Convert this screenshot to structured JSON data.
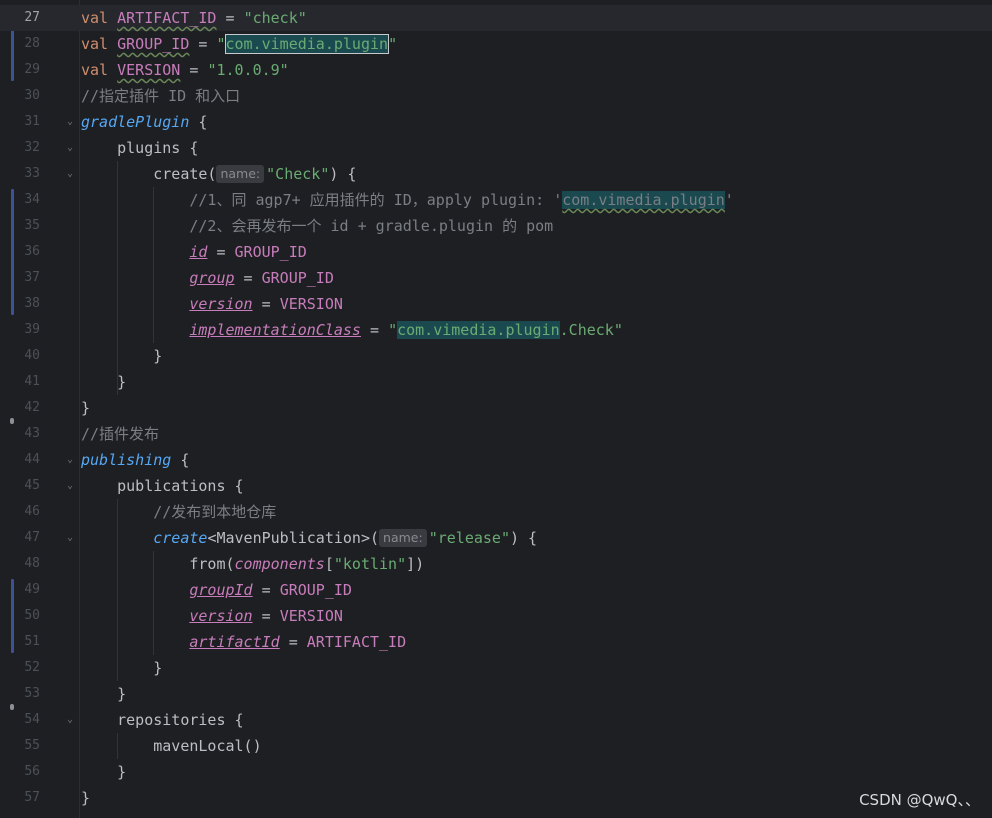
{
  "lines": {
    "l27": {
      "num": "27",
      "a": "val",
      "b": " ",
      "c": "ARTIFACT_ID",
      "d": " = ",
      "e": "\"check\""
    },
    "l28": {
      "num": "28",
      "a": "val",
      "b": " ",
      "c": "GROUP_ID",
      "d": " = ",
      "e": "\"",
      "f": "com.vimedia.plugin",
      "g": "\""
    },
    "l29": {
      "num": "29",
      "a": "val",
      "b": " ",
      "c": "VERSION",
      "d": " = ",
      "e": "\"1.0.0.9\""
    },
    "l30": {
      "num": "30",
      "a": "//指定插件 ID 和入口"
    },
    "l31": {
      "num": "31",
      "a": "gradlePlugin",
      "b": " {"
    },
    "l32": {
      "num": "32",
      "a": "    plugins {"
    },
    "l33": {
      "num": "33",
      "a": "        create(",
      "hint": "name:",
      "b": "\"Check\"",
      "c": ") {"
    },
    "l34": {
      "num": "34",
      "a": "            //1、同 agp7+ 应用插件的 ID，apply plugin: '",
      "b": "com.vimedia.plugin",
      "c": "'"
    },
    "l35": {
      "num": "35",
      "a": "            //2、会再发布一个 id + gradle.plugin 的 pom"
    },
    "l36": {
      "num": "36",
      "a": "            ",
      "b": "id",
      "c": " = ",
      "d": "GROUP_ID"
    },
    "l37": {
      "num": "37",
      "a": "            ",
      "b": "group",
      "c": " = ",
      "d": "GROUP_ID"
    },
    "l38": {
      "num": "38",
      "a": "            ",
      "b": "version",
      "c": " = ",
      "d": "VERSION"
    },
    "l39": {
      "num": "39",
      "a": "            ",
      "b": "implementationClass",
      "c": " = ",
      "d": "\"",
      "e": "com.vimedia.plugin",
      "f": ".Check\""
    },
    "l40": {
      "num": "40",
      "a": "        }"
    },
    "l41": {
      "num": "41",
      "a": "    }"
    },
    "l42": {
      "num": "42",
      "a": "}"
    },
    "l43": {
      "num": "43",
      "a": "//插件发布"
    },
    "l44": {
      "num": "44",
      "a": "publishing",
      "b": " {"
    },
    "l45": {
      "num": "45",
      "a": "    publications {"
    },
    "l46": {
      "num": "46",
      "a": "        //发布到本地仓库"
    },
    "l47": {
      "num": "47",
      "a": "        ",
      "b": "create",
      "c": "<MavenPublication>(",
      "hint": "name:",
      "d": "\"release\"",
      "e": ") {"
    },
    "l48": {
      "num": "48",
      "a": "            from(",
      "b": "components",
      "c": "[",
      "d": "\"kotlin\"",
      "e": "])"
    },
    "l49": {
      "num": "49",
      "a": "            ",
      "b": "groupId",
      "c": " = ",
      "d": "GROUP_ID"
    },
    "l50": {
      "num": "50",
      "a": "            ",
      "b": "version",
      "c": " = ",
      "d": "VERSION"
    },
    "l51": {
      "num": "51",
      "a": "            ",
      "b": "artifactId",
      "c": " = ",
      "d": "ARTIFACT_ID"
    },
    "l52": {
      "num": "52",
      "a": "        }"
    },
    "l53": {
      "num": "53",
      "a": "    }"
    },
    "l54": {
      "num": "54",
      "a": "    repositories {"
    },
    "l55": {
      "num": "55",
      "a": "        mavenLocal()"
    },
    "l56": {
      "num": "56",
      "a": "    }"
    },
    "l57": {
      "num": "57",
      "a": "}"
    }
  },
  "watermark": "CSDN @QwQ、、",
  "icons": {
    "fold": "chevron-down-icon"
  },
  "colors": {
    "keyword": "#cf8e6d",
    "string": "#6aab73",
    "comment": "#7a7e85",
    "constant": "#c77dbb",
    "function": "#56a8f5",
    "background": "#1e1f22"
  }
}
